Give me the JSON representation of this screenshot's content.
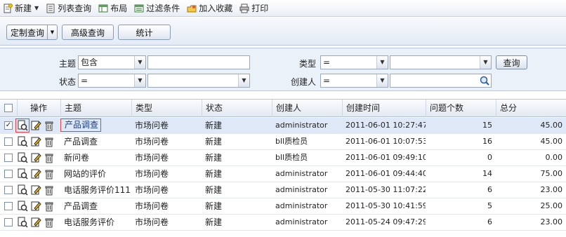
{
  "toolbar": {
    "new_label": "新建",
    "list_query_label": "列表查询",
    "layout_label": "布局",
    "filter_label": "过滤条件",
    "favorite_label": "加入收藏",
    "print_label": "打印"
  },
  "actions": {
    "custom_query_label": "定制查询",
    "advanced_query_label": "高级查询",
    "statistics_label": "统计"
  },
  "filter": {
    "subject_label": "主题",
    "subject_op": "包含",
    "status_label": "状态",
    "status_op": "=",
    "type_label": "类型",
    "type_op": "=",
    "creator_label": "创建人",
    "creator_op": "=",
    "query_button": "查询"
  },
  "grid": {
    "columns": {
      "ops": "操作",
      "subject": "主题",
      "type": "类型",
      "status": "状态",
      "creator": "创建人",
      "created": "创建时间",
      "count": "问题个数",
      "score": "总分"
    },
    "rows": [
      {
        "subject": "产品调查",
        "type": "市场问卷",
        "status": "新建",
        "creator": "administrator",
        "created": "2011-06-01 10:27:47",
        "count": "15",
        "score": "45.00"
      },
      {
        "subject": "产品调查",
        "type": "市场问卷",
        "status": "新建",
        "creator": "bll质检员",
        "created": "2011-06-01 10:07:53",
        "count": "16",
        "score": "45.00"
      },
      {
        "subject": "新问卷",
        "type": "市场问卷",
        "status": "新建",
        "creator": "bll质检员",
        "created": "2011-06-01 09:49:10",
        "count": "0",
        "score": "0.00"
      },
      {
        "subject": "网站的评价",
        "type": "市场问卷",
        "status": "新建",
        "creator": "administrator",
        "created": "2011-06-01 09:44:40",
        "count": "14",
        "score": "75.00"
      },
      {
        "subject": "电话服务评价111",
        "type": "市场问卷",
        "status": "新建",
        "creator": "administrator",
        "created": "2011-05-30 11:07:22",
        "count": "6",
        "score": "23.00"
      },
      {
        "subject": "产品调查",
        "type": "市场问卷",
        "status": "新建",
        "creator": "administrator",
        "created": "2011-05-30 10:41:59",
        "count": "5",
        "score": "25.00"
      },
      {
        "subject": "电话服务评价",
        "type": "市场问卷",
        "status": "新建",
        "creator": "administrator",
        "created": "2011-05-24 09:47:29",
        "count": "6",
        "score": "23.00"
      }
    ]
  },
  "colors": {
    "selected_row": "#dfe8f6",
    "highlight_border": "#d9434a",
    "panel_bg": "#ebf1f9"
  },
  "icons": [
    "new-icon",
    "list-query-icon",
    "layout-icon",
    "filter-icon",
    "favorite-icon",
    "print-icon",
    "view-icon",
    "edit-icon",
    "delete-icon",
    "lookup-icon"
  ]
}
